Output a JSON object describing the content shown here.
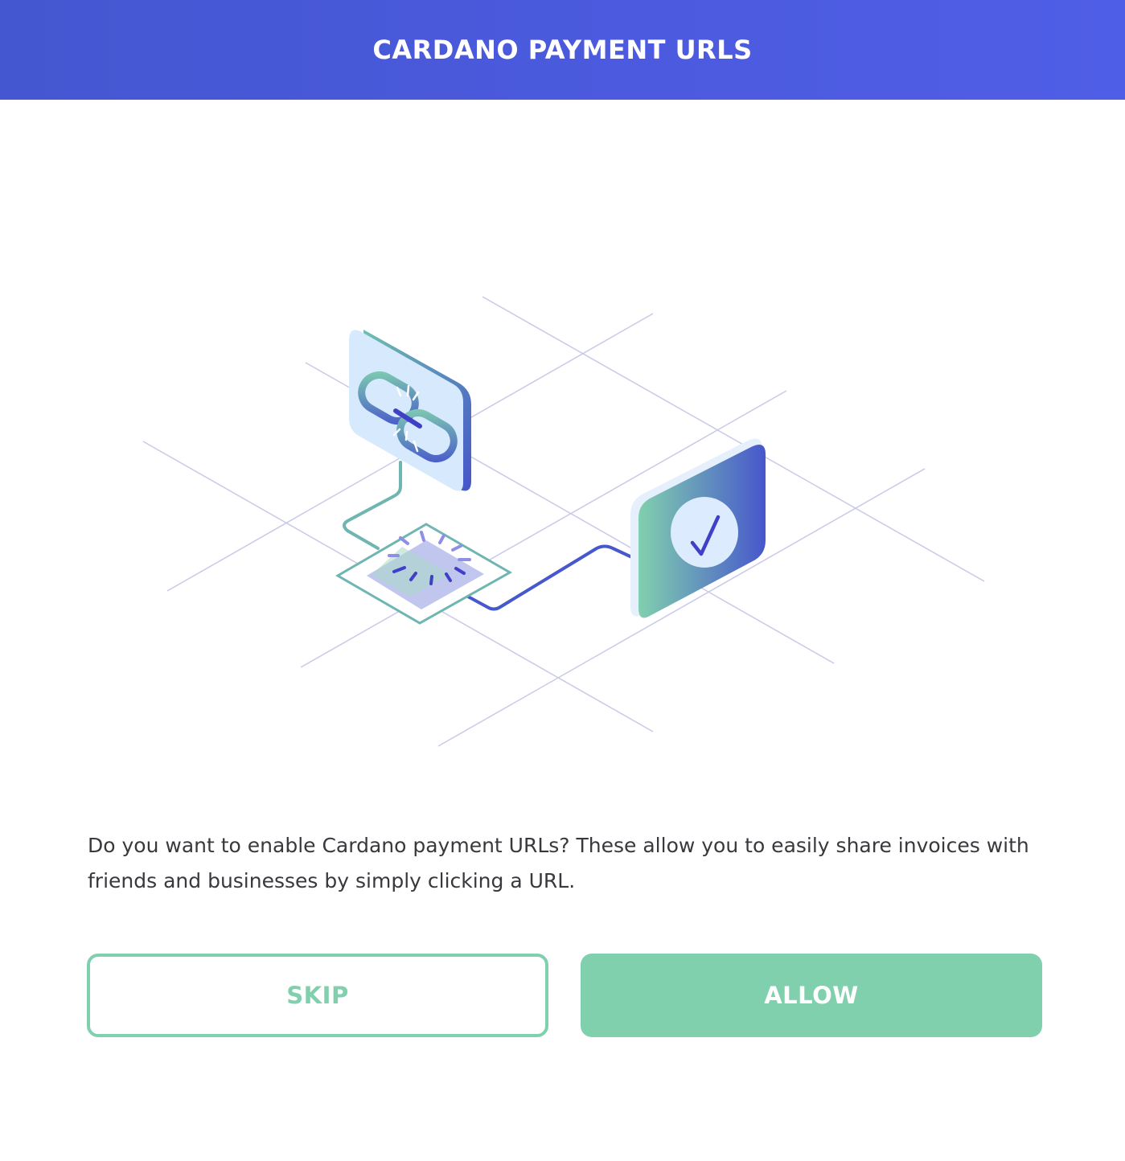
{
  "header": {
    "title": "CARDANO PAYMENT URLS"
  },
  "main": {
    "message": "Do you want to enable Cardano payment URLs? These allow you to easily share invoices with friends and businesses by simply clicking a URL."
  },
  "actions": {
    "skip_label": "SKIP",
    "allow_label": "ALLOW"
  },
  "illustration": {
    "icons": [
      "chain-link-icon",
      "checkmark-icon"
    ]
  },
  "colors": {
    "header_gradient_start": "#4457d0",
    "header_gradient_end": "#4f5ee6",
    "accent_green": "#80d0ae",
    "text": "#38393d",
    "grid_line": "#c9c9e8"
  }
}
